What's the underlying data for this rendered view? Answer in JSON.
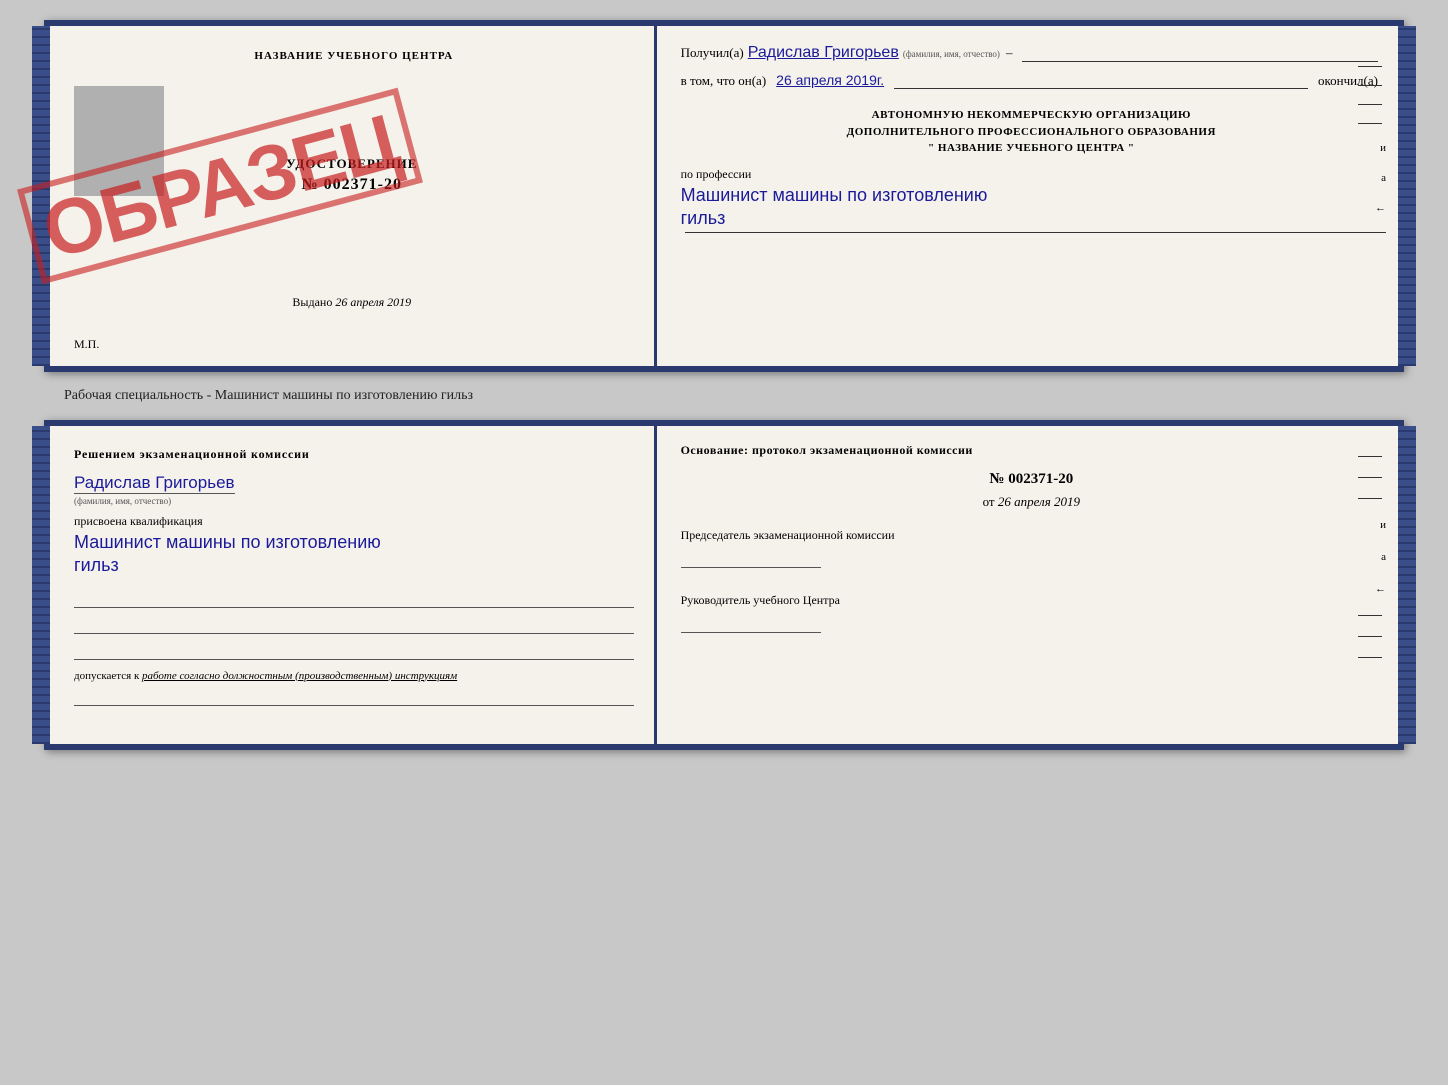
{
  "top_doc": {
    "left": {
      "school_name": "НАЗВАНИЕ УЧЕБНОГО ЦЕНТРА",
      "stamp": "ОБРАЗЕЦ",
      "udostoverenie_title": "УДОСТОВЕРЕНИЕ",
      "udostoverenie_number": "№ 002371-20",
      "vydano_label": "Выдано",
      "vydano_date": "26 апреля 2019",
      "mp": "М.П."
    },
    "right": {
      "poluchil_label": "Получил(а)",
      "recipient_name": "Радислав Григорьев",
      "fio_sub": "(фамилия, имя, отчество)",
      "vtom_label": "в том, что он(а)",
      "date_value": "26 апреля 2019г.",
      "okonchil_label": "окончил(а)",
      "center_line1": "АВТОНОМНУЮ НЕКОММЕРЧЕСКУЮ ОРГАНИЗАЦИЮ",
      "center_line2": "ДОПОЛНИТЕЛЬНОГО ПРОФЕССИОНАЛЬНОГО ОБРАЗОВАНИЯ",
      "center_line3": "\"  НАЗВАНИЕ УЧЕБНОГО ЦЕНТРА  \"",
      "profession_label": "по профессии",
      "profession_value1": "Машинист машины по изготовлению",
      "profession_value2": "гильз"
    }
  },
  "separator": {
    "text": "Рабочая специальность - Машинист машины по изготовлению гильз"
  },
  "bottom_doc": {
    "left": {
      "komissia_title": "Решением  экзаменационной  комиссии",
      "name_value": "Радислав Григорьев",
      "fio_sub": "(фамилия, имя, отчество)",
      "prisvoena": "присвоена квалификация",
      "qualification1": "Машинист  машины  по изготовлению",
      "qualification2": "гильз",
      "dopuskaetsya": "допускается к",
      "dopuskaetsya_link": "работе согласно должностным (производственным) инструкциям"
    },
    "right": {
      "osnovaniye": "Основание: протокол экзаменационной  комиссии",
      "protocol_number": "№  002371-20",
      "protocol_date_prefix": "от",
      "protocol_date": "26 апреля 2019",
      "predsedatel_title": "Председатель экзаменационной комиссии",
      "rukovoditel_title": "Руководитель учебного Центра"
    },
    "right_side": {
      "items": [
        "–",
        "–",
        "–",
        "и",
        "а",
        "←",
        "–",
        "–",
        "–"
      ]
    }
  },
  "top_right_side": {
    "items": [
      "–",
      "–",
      "–",
      "–",
      "и",
      "а",
      "←",
      "–"
    ]
  }
}
